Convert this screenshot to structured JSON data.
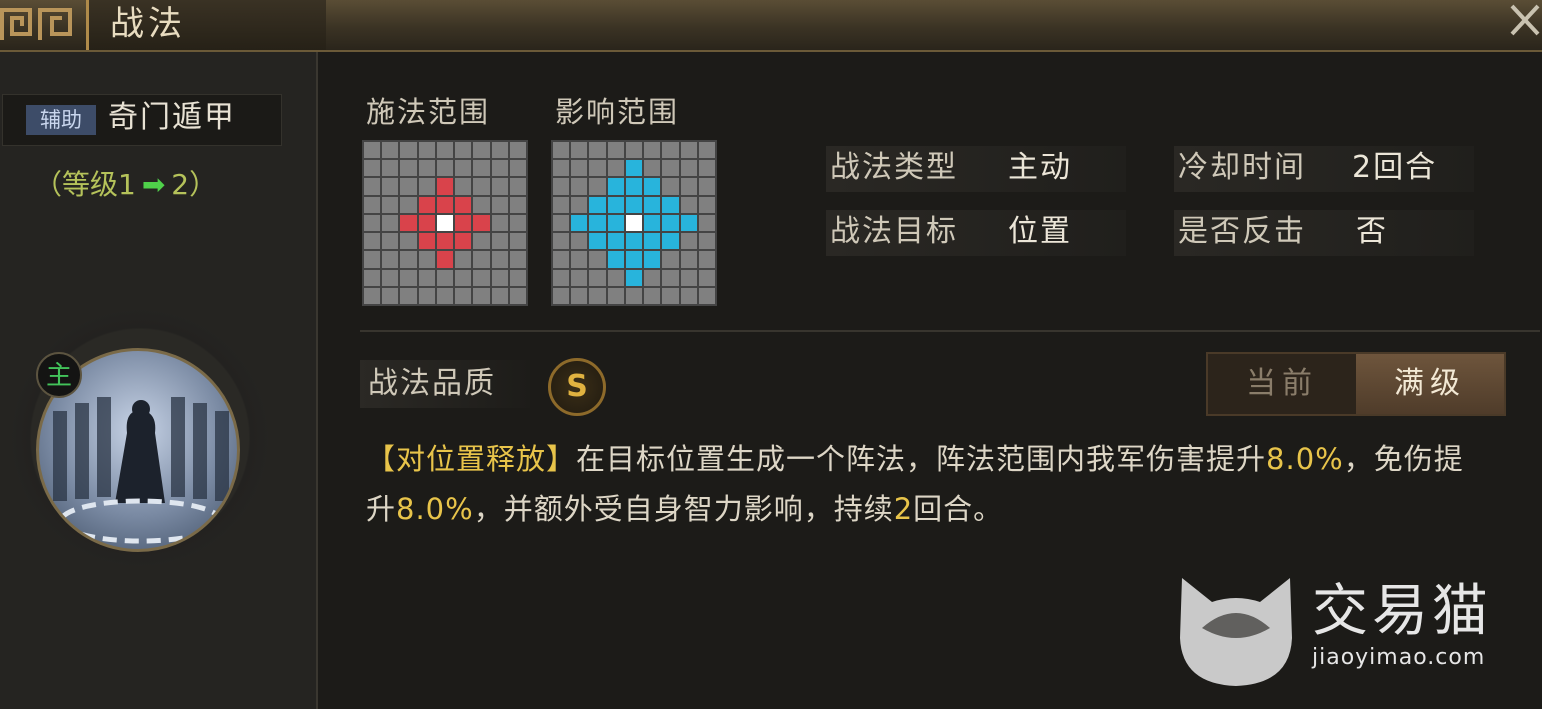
{
  "window": {
    "title": "战法"
  },
  "skill": {
    "type_badge": "辅助",
    "name": "奇门遁甲",
    "level_open": "（等级1",
    "level_arrow": "➡",
    "level_close": "2）",
    "commander_badge": "主"
  },
  "ranges": {
    "cast_label": "施法范围",
    "effect_label": "影响范围"
  },
  "stats": {
    "type_label": "战法类型",
    "type_value": "主动",
    "cooldown_label": "冷却时间",
    "cooldown_value": "2回合",
    "target_label": "战法目标",
    "target_value": "位置",
    "counter_label": "是否反击",
    "counter_value": "否"
  },
  "quality": {
    "label": "战法品质",
    "grade": "S"
  },
  "toggle": {
    "current_label": "当前",
    "max_label": "满级",
    "selected": "max"
  },
  "description": {
    "tag": "【对位置释放】",
    "text1": "在目标位置生成一个阵法，阵法范围内我军伤害提升",
    "value1": "8.0%",
    "text2": "，免伤提升",
    "value2": "8.0%",
    "text3": "，并额外受自身智力影响，持续",
    "value3": "2",
    "text4": "回合。"
  },
  "watermark": {
    "brand": "交易猫",
    "url": "jiaoyimao.com"
  },
  "colors": {
    "cast_range": "#d9434b",
    "effect_range": "#28b4dc",
    "highlight": "#e8c44a",
    "level_arrow": "#4fd14a"
  }
}
